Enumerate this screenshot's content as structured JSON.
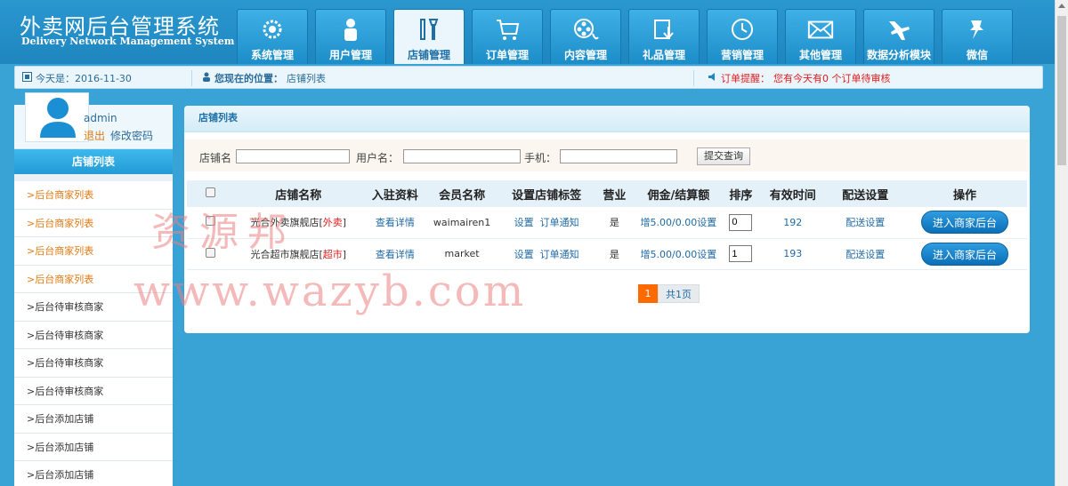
{
  "app": {
    "title_cn": "外卖网后台管理系统",
    "title_en": "Delivery Network Management System"
  },
  "nav": [
    {
      "label": "系统管理",
      "icon": "gear-icon"
    },
    {
      "label": "用户管理",
      "icon": "user-icon"
    },
    {
      "label": "店铺管理",
      "icon": "tools-icon",
      "active": true
    },
    {
      "label": "订单管理",
      "icon": "cart-icon"
    },
    {
      "label": "内容管理",
      "icon": "film-reel-icon"
    },
    {
      "label": "礼品管理",
      "icon": "download-box-icon"
    },
    {
      "label": "营销管理",
      "icon": "clock-icon"
    },
    {
      "label": "其他管理",
      "icon": "mail-icon"
    },
    {
      "label": "数据分析模块",
      "icon": "airplane-icon"
    },
    {
      "label": "微信",
      "icon": "pin-icon"
    }
  ],
  "infobar": {
    "date_label": "今天是：2016-11-30",
    "location_label": "您现在的位置：",
    "location_value": "店铺列表",
    "reminder_label": "订单提醒：",
    "reminder_text": "您有今天有0 个订单待审核"
  },
  "sidebar": {
    "username": "admin",
    "logout": "退出",
    "change_password": "修改密码",
    "section_title": "店铺列表",
    "items": [
      {
        "label": ">后台商家列表",
        "highlight": true
      },
      {
        "label": ">后台商家列表",
        "highlight": true
      },
      {
        "label": ">后台商家列表",
        "highlight": true
      },
      {
        "label": ">后台商家列表",
        "highlight": true
      },
      {
        "label": ">后台待审核商家",
        "highlight": false
      },
      {
        "label": ">后台待审核商家",
        "highlight": false
      },
      {
        "label": ">后台待审核商家",
        "highlight": false
      },
      {
        "label": ">后台待审核商家",
        "highlight": false
      },
      {
        "label": ">后台添加店铺",
        "highlight": false
      },
      {
        "label": ">后台添加店铺",
        "highlight": false
      },
      {
        "label": ">后台添加店铺",
        "highlight": false
      }
    ]
  },
  "panel": {
    "title": "店铺列表",
    "search": {
      "shop_label": "店铺名",
      "user_label": "用户名：",
      "phone_label": "手机：",
      "shop_value": "",
      "user_value": "",
      "phone_value": "",
      "submit": "提交查询"
    },
    "columns": [
      "店铺名称",
      "入驻资料",
      "会员名称",
      "设置店铺标签",
      "营业",
      "佣金/结算额",
      "排序",
      "有效时间",
      "配送设置",
      "操作"
    ],
    "rows": [
      {
        "shop": "光合外卖旗舰店",
        "tag_open": "[",
        "tag": "外卖",
        "tag_close": "]",
        "detail": "查看详情",
        "member": "waimairen1",
        "label_set": "设置",
        "order_notice": "订单通知",
        "open": "是",
        "commission": "增5.00/0.00设置",
        "sort": "0",
        "valid": "192",
        "delivery": "配送设置",
        "action": "进入商家后台"
      },
      {
        "shop": "光合超市旗舰店",
        "tag_open": "[",
        "tag": "超市",
        "tag_close": "]",
        "detail": "查看详情",
        "member": "market",
        "label_set": "设置",
        "order_notice": "订单通知",
        "open": "是",
        "commission": "增5.00/0.00设置",
        "sort": "1",
        "valid": "193",
        "delivery": "配送设置",
        "action": "进入商家后台"
      }
    ],
    "pager": {
      "current": "1",
      "total": "共1页"
    }
  },
  "watermark": {
    "line1": "资源邦",
    "line2": "www.wazyb.com"
  },
  "colors": {
    "header_blue": "#1f86bf",
    "accent_orange": "#ff6a00",
    "alert_red": "#e01c1c"
  }
}
